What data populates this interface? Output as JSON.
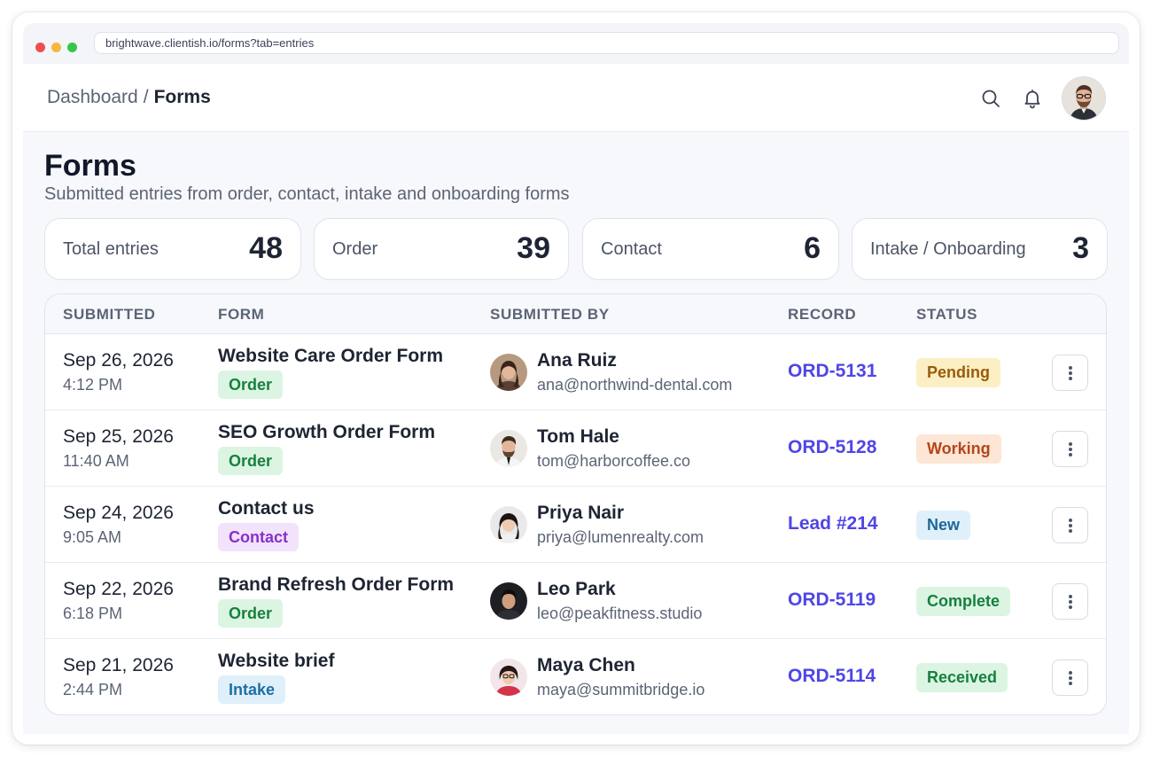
{
  "browser": {
    "url": "brightwave.clientish.io/forms?tab=entries",
    "traffic_lights": [
      "#ef4e4e",
      "#f6b73c",
      "#34c748"
    ]
  },
  "topbar": {
    "breadcrumb_parent": "Dashboard",
    "breadcrumb_separator": "/",
    "breadcrumb_current": "Forms",
    "icons": [
      "search-icon",
      "bell-icon",
      "user-avatar"
    ]
  },
  "page": {
    "title": "Forms",
    "subtitle": "Submitted entries from order, contact, intake and onboarding forms"
  },
  "stats": [
    {
      "label": "Total entries",
      "value": "48"
    },
    {
      "label": "Order",
      "value": "39"
    },
    {
      "label": "Contact",
      "value": "6"
    },
    {
      "label": "Intake / Onboarding",
      "value": "3"
    }
  ],
  "table": {
    "headers": {
      "submitted": "SUBMITTED",
      "form": "FORM",
      "submitted_by": "SUBMITTED BY",
      "record": "RECORD",
      "status": "STATUS"
    },
    "rows": [
      {
        "date": "Sep 26, 2026",
        "time": "4:12 PM",
        "form": "Website Care Order Form",
        "type": "Order",
        "name": "Ana Ruiz",
        "email": "ana@northwind-dental.com",
        "record": "ORD-5131",
        "status": "Pending"
      },
      {
        "date": "Sep 25, 2026",
        "time": "11:40 AM",
        "form": "SEO Growth Order Form",
        "type": "Order",
        "name": "Tom Hale",
        "email": "tom@harborcoffee.co",
        "record": "ORD-5128",
        "status": "Working"
      },
      {
        "date": "Sep 24, 2026",
        "time": "9:05 AM",
        "form": "Contact us",
        "type": "Contact",
        "name": "Priya Nair",
        "email": "priya@lumenrealty.com",
        "record": "Lead #214",
        "status": "New"
      },
      {
        "date": "Sep 22, 2026",
        "time": "6:18 PM",
        "form": "Brand Refresh Order Form",
        "type": "Order",
        "name": "Leo Park",
        "email": "leo@peakfitness.studio",
        "record": "ORD-5119",
        "status": "Complete"
      },
      {
        "date": "Sep 21, 2026",
        "time": "2:44 PM",
        "form": "Website brief",
        "type": "Intake",
        "name": "Maya Chen",
        "email": "maya@summitbridge.io",
        "record": "ORD-5114",
        "status": "Received"
      }
    ]
  },
  "colors": {
    "accent": "#4f46e5",
    "tag": {
      "Order": {
        "bg": "#dcf5e3",
        "fg": "#17803d"
      },
      "Contact": {
        "bg": "#f1e3fc",
        "fg": "#8a2fc9"
      },
      "Intake": {
        "bg": "#dff0fb",
        "fg": "#1d6fa5"
      }
    },
    "status": {
      "Pending": {
        "bg": "#fcefc3",
        "fg": "#9a5b0c"
      },
      "Working": {
        "bg": "#fde6d5",
        "fg": "#b4461b"
      },
      "New": {
        "bg": "#e0f0fb",
        "fg": "#1e6799"
      },
      "Complete": {
        "bg": "#dcf5e3",
        "fg": "#17803d"
      },
      "Received": {
        "bg": "#dcf5e3",
        "fg": "#17803d"
      }
    }
  }
}
